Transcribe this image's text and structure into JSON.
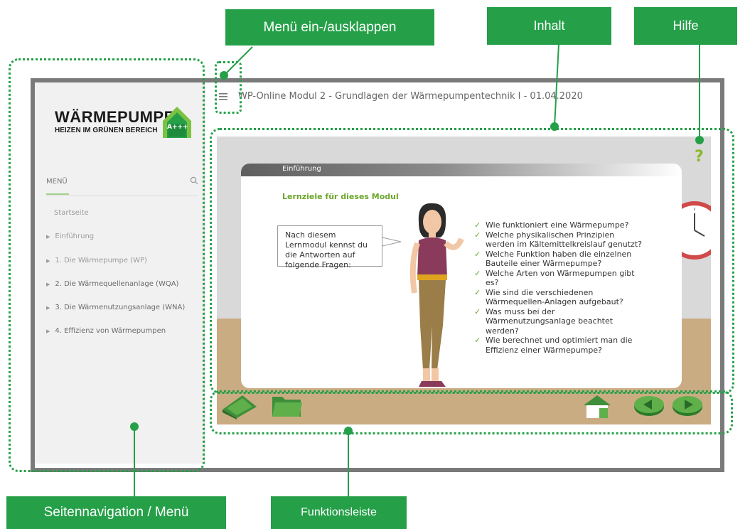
{
  "annotations": {
    "menu_toggle": "Menü ein-/ausklappen",
    "content": "Inhalt",
    "help": "Hilfe",
    "side_nav": "Seitennavigation / Menü",
    "toolbar": "Funktionsleiste"
  },
  "app": {
    "title": "WP-Online Modul 2 - Grundlagen der Wärmepumpentechnik I - 01.04.2020",
    "logo": {
      "title": "WÄRMEPUMPE",
      "subtitle": "HEIZEN IM GRÜNEN BEREICH",
      "badge": "A+++"
    }
  },
  "sidebar": {
    "menu_label": "MENÜ",
    "items": [
      {
        "label": "Startseite",
        "arrow": false
      },
      {
        "label": "Einführung",
        "arrow": true
      },
      {
        "label": "1. Die Wärmepumpe (WP)",
        "arrow": true
      },
      {
        "label": "2. Die Wärmequellenanlage (WQA)",
        "arrow": true
      },
      {
        "label": "3. Die Wärmenutzungsanlage (WNA)",
        "arrow": true
      },
      {
        "label": "4. Effizienz von Wärmepumpen",
        "arrow": true
      }
    ]
  },
  "content": {
    "section": "Einführung",
    "heading": "Lernziele für dieses Modul",
    "bubble": "Nach diesem Lernmodul kennst du die Antworten auf folgende Fragen:",
    "questions": [
      "Wie funktioniert eine Wärmepumpe?",
      "Welche physikalischen Prinzipien werden im Kältemittelkreislauf genutzt?",
      "Welche Funktion haben die einzelnen Bauteile einer Wärmepumpe?",
      "Welche Arten von Wärmepumpen gibt es?",
      "Wie sind die verschiedenen Wärmequellen-Anlagen aufgebaut?",
      "Was muss bei der Wärmenutzungsanlage beachtet werden?",
      "Wie berechnet und optimiert man die Effizienz einer Wärmepumpe?"
    ],
    "help_symbol": "?"
  },
  "colors": {
    "accent": "#25a048",
    "frame": "#7a7a7a",
    "floor": "#c9ac82",
    "wall": "#d9d9d9",
    "heading": "#6aa62a"
  },
  "icons": [
    "hamburger-icon",
    "search-icon",
    "help-icon",
    "book-icon",
    "folder-icon",
    "home-icon",
    "prev-arrow-icon",
    "next-arrow-icon",
    "clock-icon"
  ]
}
